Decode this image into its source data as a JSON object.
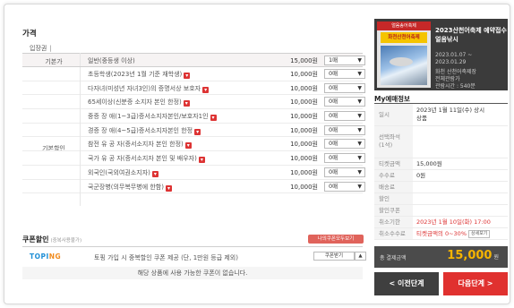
{
  "price_section": {
    "title": "가격",
    "ticket_tab": "입장권",
    "tab_separator": "|",
    "general_category": "기본가",
    "discount_category": "기본할인",
    "rows": [
      {
        "name": "일반(중등생 이상)",
        "price": "15,000원",
        "qty": "1매",
        "has_info": false
      },
      {
        "name": "초등학생(2023년 1월 기준 재학생)",
        "price": "10,000원",
        "qty": "0매",
        "has_info": true
      },
      {
        "name": "다자녀(미성년 자녀3인)의 증명서상 보호자",
        "price": "10,000원",
        "qty": "0매",
        "has_info": true
      },
      {
        "name": "65세이상(신분증 소지자 본인 한정)",
        "price": "10,000원",
        "qty": "0매",
        "has_info": true
      },
      {
        "name": "중증 장 애(1~3급)증서소지자본인/보호자1인",
        "price": "10,000원",
        "qty": "0매",
        "has_info": true
      },
      {
        "name": "경증 장 애(4~5급)증서소지자본인 한정",
        "price": "10,000원",
        "qty": "0매",
        "has_info": true
      },
      {
        "name": "참전 유 공 자(증서소지자 본인 한정)",
        "price": "10,000원",
        "qty": "0매",
        "has_info": true
      },
      {
        "name": "국가 유 공 자(증서소지자 본인 및 배우자)",
        "price": "10,000원",
        "qty": "0매",
        "has_info": true
      },
      {
        "name": "외국인(국외여권소지자)",
        "price": "10,000원",
        "qty": "0매",
        "has_info": true
      },
      {
        "name": "국군장병(의무복무병에 한함)",
        "price": "10,000원",
        "qty": "0매",
        "has_info": true
      }
    ]
  },
  "coupon": {
    "title": "쿠폰할인",
    "subtitle": "(중복사용불가)",
    "my_coupon_button": "나의쿠폰모두보기",
    "brand_main": "TOPI",
    "brand_accent": "NG",
    "desc": "토핑 가입 시 중복할인 쿠폰 제공 (단, 1만원 등급 제외)",
    "download_button": "쿠폰받기",
    "download_arrow": "▲",
    "empty_msg": "해당 상품에 사용 가능한 쿠폰이 없습니다."
  },
  "event": {
    "poster_top": "얼음송어축제",
    "poster_mid": "화천산천어축제",
    "title": "2023산천어축제 예약접수 얼음낚시",
    "period_start": "2023.01.07 ~",
    "period_end": "2023.01.29",
    "venue": "화천 산천어축제장",
    "rating": "전체관람가",
    "runtime": "관람시간 : 540분"
  },
  "my_info": {
    "title": "My예매정보",
    "rows": [
      {
        "key": "일시",
        "value1": "2023년 1월 11일(수) 상시",
        "value2": "상품"
      },
      {
        "key": "선택좌석\n(1석)",
        "value1": ""
      },
      {
        "key": "티켓금액",
        "value1": "15,000원"
      },
      {
        "key": "수수료",
        "value1": "0원"
      },
      {
        "key": "배송료",
        "value1": ""
      },
      {
        "key": "할인",
        "value1": ""
      },
      {
        "key": "할인쿠폰",
        "value1": ""
      },
      {
        "key": "취소기한",
        "value1": "2023년 1월 10일(화) 17:00"
      },
      {
        "key": "취소수수료",
        "value1": "티켓금액의 0~30%",
        "detail_button": "상세보기"
      }
    ]
  },
  "total": {
    "label": "총 결제금액",
    "amount": "15,000",
    "unit": "원"
  },
  "nav": {
    "prev": "< 이전단계",
    "next": "다음단계 >"
  },
  "colors": {
    "accent_red": "#e0312f",
    "dark": "#3f3f3f",
    "gold": "#f5b400",
    "info_red": "#d33"
  }
}
